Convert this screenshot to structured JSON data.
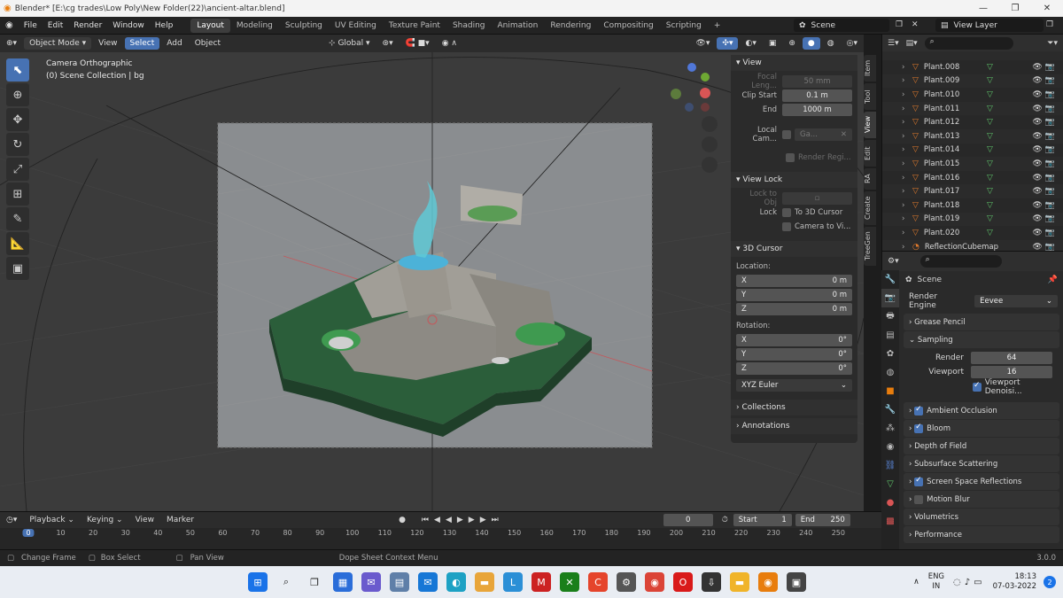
{
  "titlebar": {
    "title": "Blender* [E:\\cg trades\\Low Poly\\New Folder(22)\\ancient-altar.blend]",
    "minimize": "—",
    "maximize": "❐",
    "close": "✕"
  },
  "menu": {
    "items": [
      "File",
      "Edit",
      "Render",
      "Window",
      "Help"
    ]
  },
  "workspaces": {
    "tabs": [
      "Layout",
      "Modeling",
      "Sculpting",
      "UV Editing",
      "Texture Paint",
      "Shading",
      "Animation",
      "Rendering",
      "Compositing",
      "Scripting"
    ],
    "active": "Layout",
    "add": "+"
  },
  "scene": {
    "name": "Scene",
    "view_layer": "View Layer"
  },
  "viewport_header": {
    "mode": "Object Mode",
    "view": "View",
    "select": "Select",
    "add": "Add",
    "object": "Object",
    "orientation": "Global"
  },
  "viewport": {
    "camera_label": "Camera Orthographic",
    "collection_label": "(0) Scene Collection | bg"
  },
  "npanel": {
    "view": {
      "title": "View",
      "focal_label": "Focal Leng...",
      "focal_value": "50 mm",
      "clip_start_label": "Clip Start",
      "clip_start_value": "0.1 m",
      "end_label": "End",
      "end_value": "1000 m",
      "local_cam_label": "Local Cam...",
      "local_cam_value": "Ga...",
      "render_region": "Render Regi..."
    },
    "view_lock": {
      "title": "View Lock",
      "lock_obj_label": "Lock to Obj",
      "lock_label": "Lock",
      "to_cursor": "To 3D Cursor",
      "camera_to_view": "Camera to Vi..."
    },
    "cursor": {
      "title": "3D Cursor",
      "location_label": "Location:",
      "x_label": "X",
      "x": "0 m",
      "y_label": "Y",
      "y": "0 m",
      "z_label": "Z",
      "z": "0 m",
      "rotation_label": "Rotation:",
      "rx": "0°",
      "ry": "0°",
      "rz": "0°",
      "mode": "XYZ Euler"
    },
    "collections": "Collections",
    "annotations": "Annotations"
  },
  "sidetabs": [
    "Item",
    "Tool",
    "View",
    "Edit",
    "RA",
    "Create",
    "TreeGen"
  ],
  "outliner": {
    "rows": [
      "Plant.008",
      "Plant.009",
      "Plant.010",
      "Plant.011",
      "Plant.012",
      "Plant.013",
      "Plant.014",
      "Plant.015",
      "Plant.016",
      "Plant.017",
      "Plant.018",
      "Plant.019",
      "Plant.020",
      "ReflectionCubemap"
    ]
  },
  "properties": {
    "scene": "Scene",
    "render_engine_label": "Render Engine",
    "render_engine": "Eevee",
    "sections": {
      "grease_pencil": "Grease Pencil",
      "sampling": "Sampling",
      "ambient_occlusion": "Ambient Occlusion",
      "bloom": "Bloom",
      "depth_of_field": "Depth of Field",
      "subsurface": "Subsurface Scattering",
      "ssr": "Screen Space Reflections",
      "motion_blur": "Motion Blur",
      "volumetrics": "Volumetrics",
      "performance": "Performance"
    },
    "render_label": "Render",
    "render_value": "64",
    "viewport_label": "Viewport",
    "viewport_value": "16",
    "viewport_denoise": "Viewport Denoisi..."
  },
  "timeline": {
    "playback": "Playback",
    "keying": "Keying",
    "view": "View",
    "marker": "Marker",
    "current": "0",
    "start_label": "Start",
    "start": "1",
    "end_label": "End",
    "end": "250",
    "ticks": [
      "0",
      "10",
      "20",
      "30",
      "40",
      "50",
      "60",
      "70",
      "80",
      "90",
      "100",
      "110",
      "120",
      "130",
      "140",
      "150",
      "160",
      "170",
      "180",
      "190",
      "200",
      "210",
      "220",
      "230",
      "240",
      "250"
    ]
  },
  "statusbar": {
    "change_frame": "Change Frame",
    "box_select": "Box Select",
    "pan_view": "Pan View",
    "context_menu": "Dope Sheet Context Menu",
    "version": "3.0.0"
  },
  "taskbar": {
    "lang": "ENG",
    "region": "IN",
    "time": "18:13",
    "date": "07-03-2022",
    "notif": "2"
  }
}
